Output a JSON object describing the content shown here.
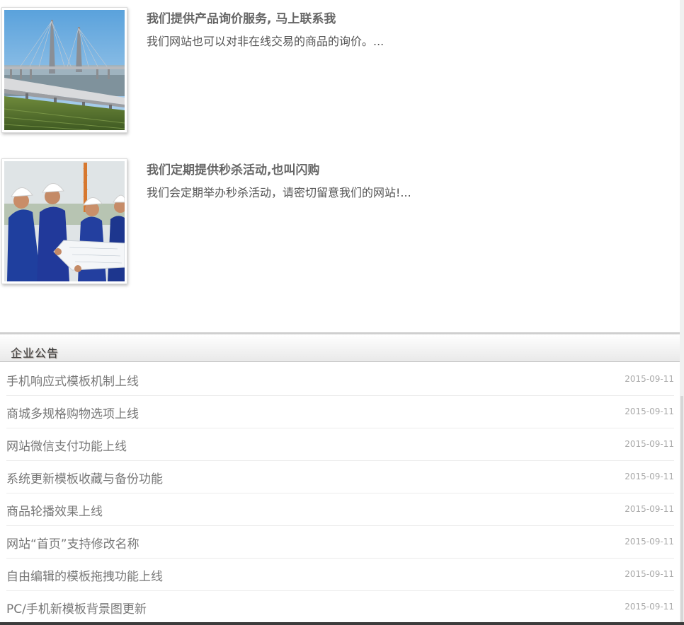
{
  "news": [
    {
      "title": "我们提供产品询价服务, 马上联系我",
      "desc": "我们网站也可以对非在线交易的商品的询价。...",
      "image_icon": "bridge-photo"
    },
    {
      "title": "我们定期提供秒杀活动,也叫闪购",
      "desc": "我们会定期举办秒杀活动，请密切留意我们的网站!...",
      "image_icon": "workers-photo"
    }
  ],
  "notices": {
    "title": "企业公告",
    "items": [
      {
        "text": "手机响应式模板机制上线",
        "date": "2015-09-11"
      },
      {
        "text": "商城多规格购物选项上线",
        "date": "2015-09-11"
      },
      {
        "text": "网站微信支付功能上线",
        "date": "2015-09-11"
      },
      {
        "text": "系统更新模板收藏与备份功能",
        "date": "2015-09-11"
      },
      {
        "text": "商品轮播效果上线",
        "date": "2015-09-11"
      },
      {
        "text": "网站“首页”支持修改名称",
        "date": "2015-09-11"
      },
      {
        "text": "自由编辑的模板拖拽功能上线",
        "date": "2015-09-11"
      },
      {
        "text": "PC/手机新模板背景图更新",
        "date": "2015-09-11"
      }
    ]
  }
}
